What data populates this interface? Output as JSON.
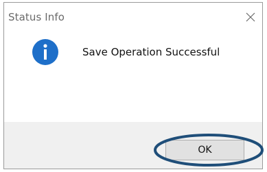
{
  "window": {
    "title": "Status Info",
    "close_icon": "close-icon"
  },
  "content": {
    "icon": "info-icon",
    "icon_color": "#1e6fc9",
    "message": "Save Operation Successful"
  },
  "buttons": {
    "ok_label": "OK"
  },
  "annotation": {
    "ring_color": "#1f4e79"
  }
}
